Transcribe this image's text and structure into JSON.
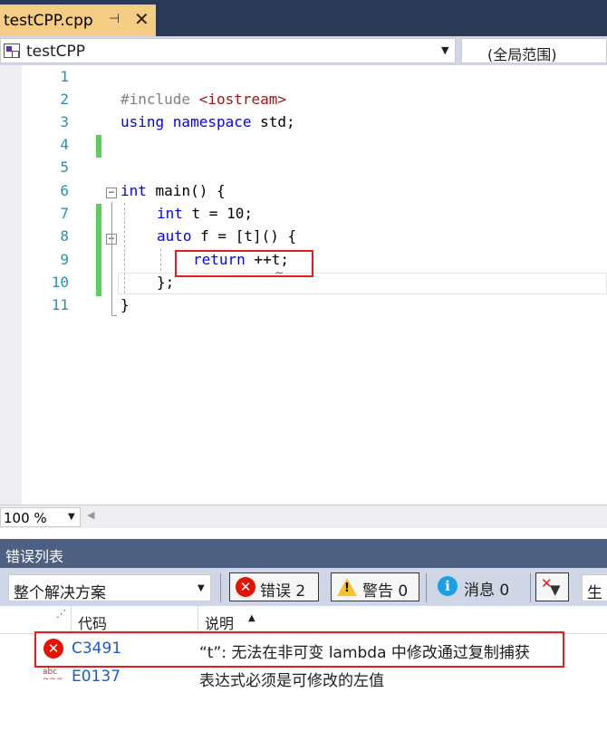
{
  "tab": {
    "title": "testCPP.cpp",
    "pin": "⊣",
    "close": "✕"
  },
  "nav": {
    "project": "testCPP",
    "scope": "(全局范围)"
  },
  "editor": {
    "line_numbers": [
      "1",
      "2",
      "3",
      "4",
      "5",
      "6",
      "7",
      "8",
      "9",
      "10",
      "11"
    ],
    "lines": {
      "l2_kw": "#include ",
      "l2_str": "<iostream>",
      "l3_kw": "using namespace",
      "l3_rest": " std;",
      "l6_kw": "int",
      "l6_rest": " main() {",
      "l7_kw": "int",
      "l7_rest": " t = 10;",
      "l8_kw": "auto",
      "l8_rest": " f = [t]() {",
      "l9_kw": "return",
      "l9_rest": " ++t;",
      "l10": "};",
      "l11": "}"
    },
    "fold_symbol": "−",
    "zoom": "100 %"
  },
  "error_list": {
    "title": "错误列表",
    "scope_filter": "整个解决方案",
    "errors_btn": "错误 2",
    "warnings_btn": "警告 0",
    "messages_btn": "消息 0",
    "build_filter": "生成",
    "columns": {
      "code": "代码",
      "desc": "说明"
    },
    "rows": [
      {
        "code": "C3491",
        "desc": "“t”: 无法在非可变 lambda 中修改通过复制捕获"
      },
      {
        "code": "E0137",
        "desc": "表达式必须是可修改的左值"
      }
    ]
  },
  "colors": {
    "error": "#e51400",
    "highlight": "#e02020",
    "keyword": "#0000ff",
    "line_number": "#2b91af",
    "tab": "#f5cc84"
  }
}
